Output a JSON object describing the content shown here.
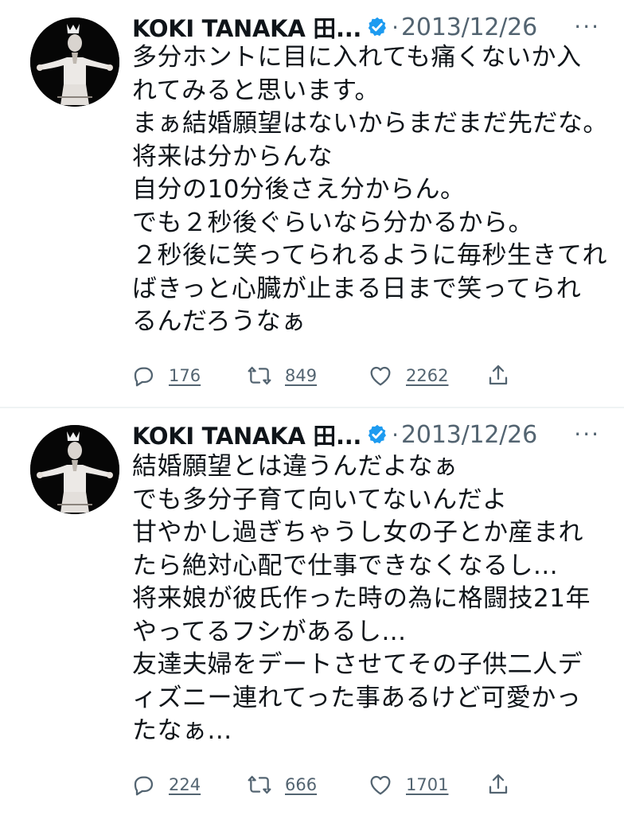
{
  "tweets": [
    {
      "author": "KOKI TANAKA 田...",
      "separator": "·",
      "date": "2013/12/26",
      "more": "···",
      "text": "多分ホントに目に入れても痛くないか入\nれてみると思います。\nまぁ結婚願望はないからまだまだ先だな。\n将来は分からんな\n自分の10分後さえ分からん。\nでも２秒後ぐらいなら分かるから。\n２秒後に笑ってられるように毎秒生きてれ\nばきっと心臓が止まる日まで笑ってられ\nるんだろうなぁ",
      "replies": "176",
      "retweets": "849",
      "likes": "2262"
    },
    {
      "author": "KOKI TANAKA 田...",
      "separator": "·",
      "date": "2013/12/26",
      "more": "···",
      "text": "結婚願望とは違うんだよなぁ\nでも多分子育て向いてないんだよ\n甘やかし過ぎちゃうし女の子とか産まれ\nたら絶対心配で仕事できなくなるし...\n将来娘が彼氏作った時の為に格闘技21年\nやってるフシがあるし...\n友達夫婦をデートさせてその子供二人デ\nィズニー連れてった事あるけど可愛かっ\nたなぁ...",
      "replies": "224",
      "retweets": "666",
      "likes": "1701"
    }
  ],
  "icons": {
    "verified": "verified-badge-icon",
    "reply": "reply-icon",
    "retweet": "retweet-icon",
    "like": "heart-icon",
    "share": "share-icon"
  },
  "colors": {
    "text": "#0f1419",
    "secondary": "#536471",
    "verified": "#1d9bf0",
    "divider": "#eff3f4"
  }
}
